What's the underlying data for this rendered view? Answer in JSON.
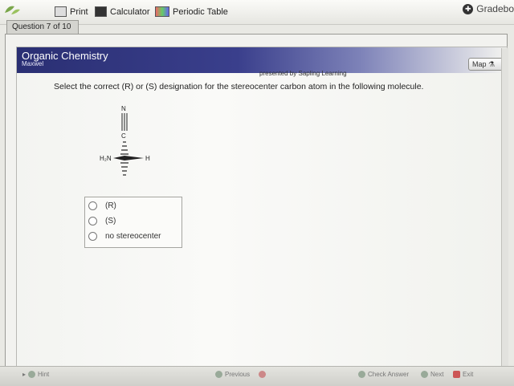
{
  "toolbar": {
    "print_label": "Print",
    "calculator_label": "Calculator",
    "periodic_table_label": "Periodic Table",
    "gradebook_label": "Gradebo"
  },
  "question_tab": "Question 7 of 10",
  "banner": {
    "title": "Organic Chemistry",
    "subtitle": "Maxwel",
    "presented_by": "presented by Sapling Learning",
    "map_label": "Map"
  },
  "question": {
    "prompt": "Select the correct (R) or (S) designation for the stereocenter carbon atom in the following molecule.",
    "molecule_labels": {
      "top": "N",
      "carbon": "C",
      "left": "H₂N",
      "right": "H"
    },
    "choices": [
      "(R)",
      "(S)",
      "no stereocenter"
    ]
  },
  "bottom": {
    "hint_label": "Hint",
    "previous_label": "Previous",
    "check_label": "Check Answer",
    "next_label": "Next",
    "exit_label": "Exit"
  }
}
